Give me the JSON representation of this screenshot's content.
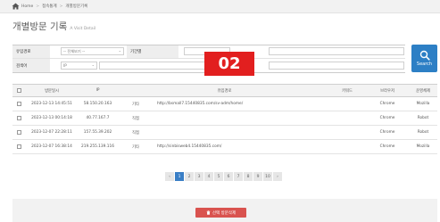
{
  "breadcrumb": {
    "home": "Home",
    "section": "접속통계",
    "page": "개별방문기록"
  },
  "title": {
    "main": "개별방문 기록",
    "sub": "A Visit Detail"
  },
  "filter": {
    "source_label": "유입경로",
    "source_value": "-- 전체보기 --",
    "period_label": "기간별",
    "keyword_label": "검색어",
    "field_value": "IP",
    "keyword_value": ""
  },
  "search_button": {
    "label": "Search"
  },
  "badge": {
    "text": "02",
    "color": "#e21f1f"
  },
  "table": {
    "headers": [
      "방문일시",
      "IP",
      "유입경로",
      "키워드",
      "브라우저",
      "운영체제"
    ],
    "rows": [
      {
        "date": "2023-12-13 14:45:51",
        "ip": "58.150.20.163",
        "type": "기타",
        "source": "http://bsmall7.15440835.com/sv-adm/home/",
        "keyword": "",
        "browser": "Chrome",
        "os": "Mozilla"
      },
      {
        "date": "2023-12-13 00:14:18",
        "ip": "40.77.167.7",
        "type": "직접",
        "source": "",
        "keyword": "",
        "browser": "Chrome",
        "os": "Robot"
      },
      {
        "date": "2023-12-07 22:28:11",
        "ip": "157.55.39.202",
        "type": "직접",
        "source": "",
        "keyword": "",
        "browser": "Chrome",
        "os": "Robot"
      },
      {
        "date": "2023-12-07 16:38:14",
        "ip": "219.255.139.116",
        "type": "기타",
        "source": "http://sinbisweb4.15440835.com/",
        "keyword": "",
        "browser": "Chrome",
        "os": "Mozilla"
      }
    ]
  },
  "pagination": {
    "prev": "‹",
    "pages": [
      "1",
      "2",
      "3",
      "4",
      "5",
      "6",
      "7",
      "8",
      "9",
      "10"
    ],
    "next": "›",
    "current": "1"
  },
  "delete_button": {
    "label": "선택 방문삭제"
  },
  "colors": {
    "accent": "#2d7fc5",
    "danger": "#d9534f"
  }
}
